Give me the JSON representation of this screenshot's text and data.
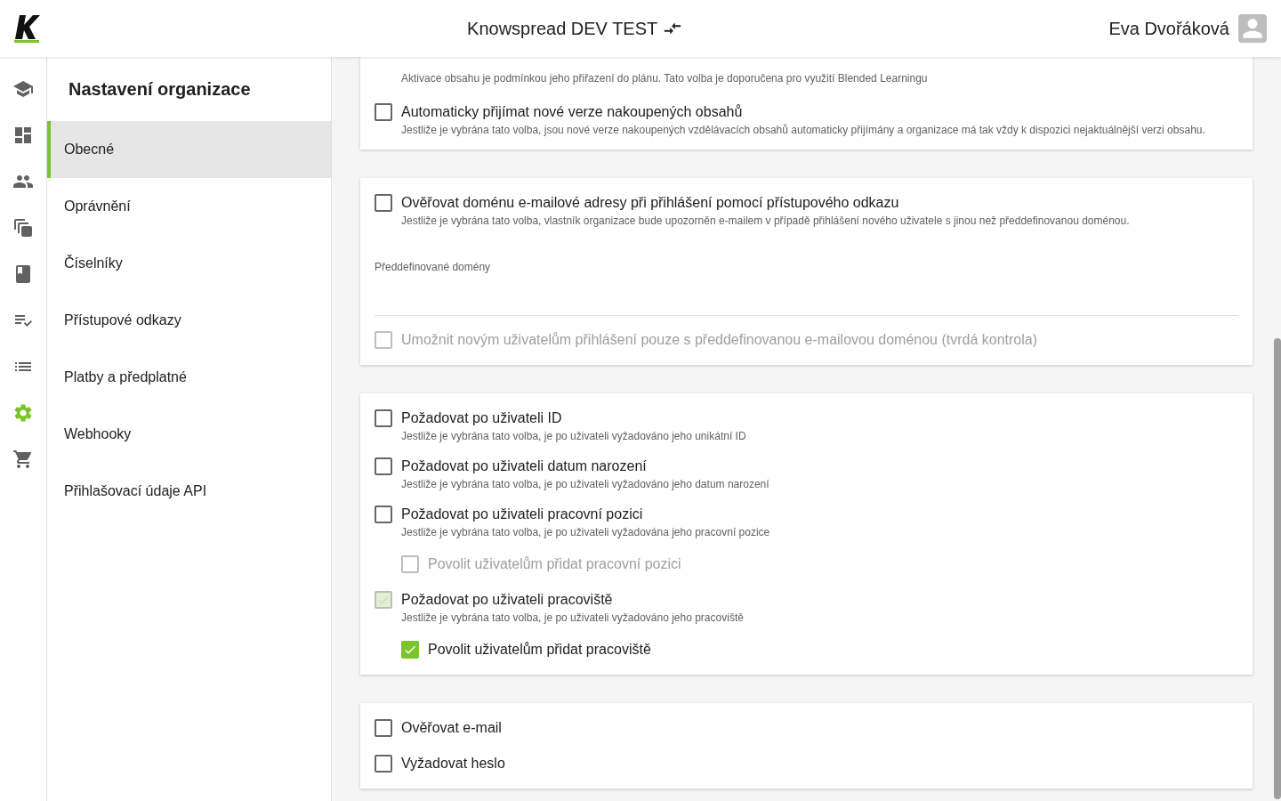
{
  "header": {
    "title": "Knowspread DEV TEST",
    "user": "Eva Dvořáková"
  },
  "rail": [
    {
      "selected": false
    },
    {
      "selected": false
    },
    {
      "selected": false
    },
    {
      "selected": false
    },
    {
      "selected": false
    },
    {
      "selected": false
    },
    {
      "selected": false
    },
    {
      "selected": true
    },
    {
      "selected": false
    }
  ],
  "nav": {
    "title": "Nastavení organizace",
    "items": [
      {
        "label": "Obecné",
        "selected": true
      },
      {
        "label": "Oprávnění",
        "selected": false
      },
      {
        "label": "Číselníky",
        "selected": false
      },
      {
        "label": "Přístupové odkazy",
        "selected": false
      },
      {
        "label": "Platby a předplatné",
        "selected": false
      },
      {
        "label": "Webhooky",
        "selected": false
      },
      {
        "label": "Přihlašovací údaje API",
        "selected": false
      }
    ]
  },
  "cards": [
    {
      "items": [
        {
          "kind": "cut_option",
          "description": "Aktivace obsahu je podmínkou jeho přiřazení do plánu. Tato volba je doporučena pro využití Blended Learningu"
        },
        {
          "kind": "option",
          "label": "Automaticky přijímat nové verze nakoupených obsahů",
          "description": "Jestliže je vybrána tato volba, jsou nové verze nakoupených vzdělávacích obsahů automaticky přijímány a organizace má tak vždy k dispozici nejaktuálnější verzi obsahu.",
          "checked": false,
          "disabled": false
        }
      ]
    },
    {
      "items": [
        {
          "kind": "option",
          "label": "Ověřovat doménu e-mailové adresy při přihlášení pomocí přístupového odkazu",
          "description": "Jestliže je vybrána tato volba, vlastník organizace bude upozorněn e-mailem v případě přihlášení nového uživatele s jinou než předdefinovanou doménou.",
          "checked": false,
          "disabled": false
        },
        {
          "kind": "field",
          "label": "Předdefinované domény"
        },
        {
          "kind": "option",
          "label": "Umožnit novým uživatelům přihlášení pouze s předdefinovanou e-mailovou doménou (tvrdá kontrola)",
          "checked": false,
          "disabled": true
        }
      ]
    },
    {
      "items": [
        {
          "kind": "option",
          "label": "Požadovat po uživateli ID",
          "description": "Jestliže je vybrána tato volba, je po uživateli vyžadováno jeho unikátní ID",
          "checked": false,
          "disabled": false
        },
        {
          "kind": "option",
          "label": "Požadovat po uživateli datum narození",
          "description": "Jestliže je vybrána tato volba, je po uživateli vyžadováno jeho datum narození",
          "checked": false,
          "disabled": false
        },
        {
          "kind": "option",
          "label": "Požadovat po uživateli pracovní pozici",
          "description": "Jestliže je vybrána tato volba, je po uživateli vyžadována jeho pracovní pozice",
          "checked": false,
          "disabled": false,
          "children": [
            {
              "kind": "option",
              "label": "Povolit uživatelům přidat pracovní pozici",
              "checked": false,
              "disabled": true
            }
          ]
        },
        {
          "kind": "option",
          "label": "Požadovat po uživateli pracoviště",
          "description": "Jestliže je vybrána tato volba, je po uživateli vyžadováno jeho pracoviště",
          "checked": true,
          "disabled": true,
          "children": [
            {
              "kind": "option",
              "label": "Povolit uživatelům přidat pracoviště",
              "checked": true,
              "disabled": false
            }
          ]
        }
      ]
    },
    {
      "items": [
        {
          "kind": "option",
          "label": "Ověřovat e-mail",
          "checked": false,
          "disabled": false
        },
        {
          "kind": "option",
          "label": "Vyžadovat heslo",
          "checked": false,
          "disabled": false
        }
      ]
    }
  ]
}
